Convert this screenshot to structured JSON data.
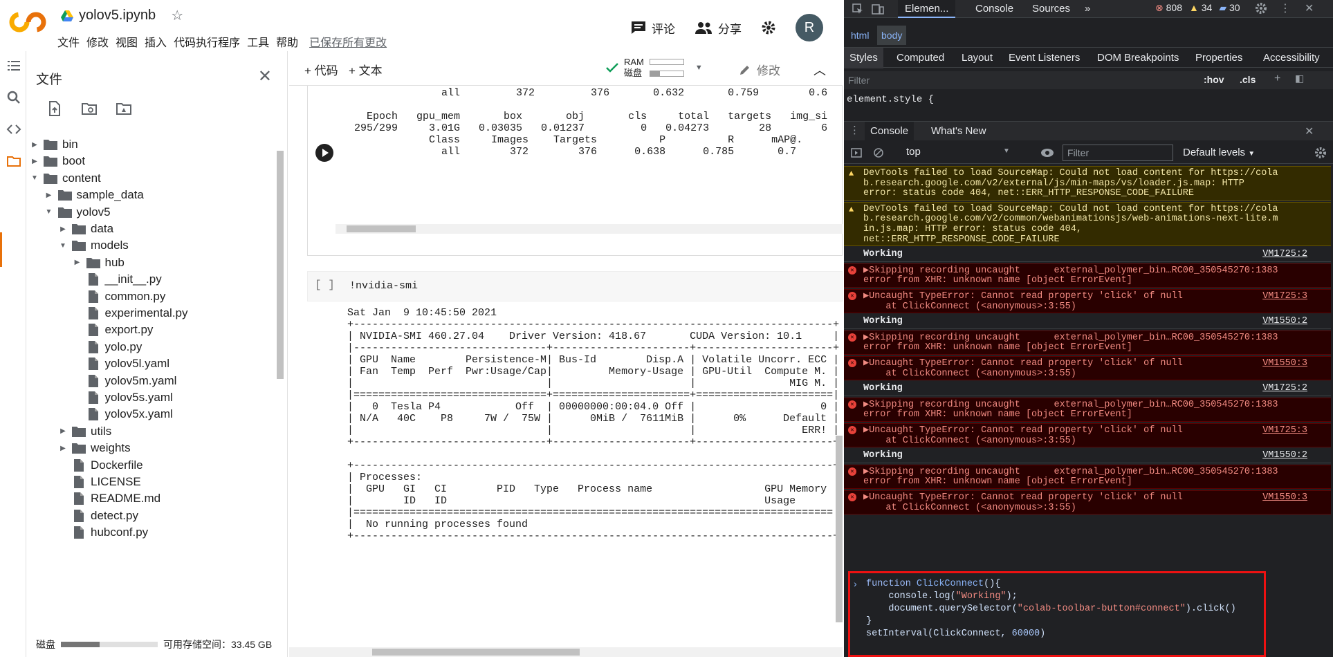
{
  "colab": {
    "logo_text": "CO",
    "notebook_title": "yolov5.ipynb",
    "menu": [
      "文件",
      "修改",
      "视图",
      "插入",
      "代码执行程序",
      "工具",
      "帮助"
    ],
    "saved_status": "已保存所有更改",
    "comment_label": "评论",
    "share_label": "分享",
    "avatar_letter": "R",
    "panel_title": "文件",
    "add_code": "+ 代码",
    "add_text": "+ 文本",
    "ram_label": "RAM",
    "disk_label": "磁盘",
    "ram_usage": 0.0,
    "disk_usage_bar": 0.3,
    "edit_label": "修改",
    "disk_footer_label": "磁盘",
    "disk_footer_usage": 0.4,
    "disk_available": "可用存储空间：33.45 GB",
    "tree": [
      {
        "name": "bin",
        "type": "folder",
        "depth": 0,
        "arrow": "right"
      },
      {
        "name": "boot",
        "type": "folder",
        "depth": 0,
        "arrow": "right"
      },
      {
        "name": "content",
        "type": "folder",
        "depth": 0,
        "arrow": "down"
      },
      {
        "name": "sample_data",
        "type": "folder",
        "depth": 1,
        "arrow": "right"
      },
      {
        "name": "yolov5",
        "type": "folder",
        "depth": 1,
        "arrow": "down"
      },
      {
        "name": "data",
        "type": "folder",
        "depth": 2,
        "arrow": "right"
      },
      {
        "name": "models",
        "type": "folder",
        "depth": 2,
        "arrow": "down"
      },
      {
        "name": "hub",
        "type": "folder",
        "depth": 3,
        "arrow": "right"
      },
      {
        "name": "__init__.py",
        "type": "file",
        "depth": 3,
        "arrow": ""
      },
      {
        "name": "common.py",
        "type": "file",
        "depth": 3,
        "arrow": ""
      },
      {
        "name": "experimental.py",
        "type": "file",
        "depth": 3,
        "arrow": ""
      },
      {
        "name": "export.py",
        "type": "file",
        "depth": 3,
        "arrow": ""
      },
      {
        "name": "yolo.py",
        "type": "file",
        "depth": 3,
        "arrow": ""
      },
      {
        "name": "yolov5l.yaml",
        "type": "file",
        "depth": 3,
        "arrow": ""
      },
      {
        "name": "yolov5m.yaml",
        "type": "file",
        "depth": 3,
        "arrow": ""
      },
      {
        "name": "yolov5s.yaml",
        "type": "file",
        "depth": 3,
        "arrow": ""
      },
      {
        "name": "yolov5x.yaml",
        "type": "file",
        "depth": 3,
        "arrow": ""
      },
      {
        "name": "utils",
        "type": "folder",
        "depth": 2,
        "arrow": "right"
      },
      {
        "name": "weights",
        "type": "folder",
        "depth": 2,
        "arrow": "right"
      },
      {
        "name": "Dockerfile",
        "type": "file",
        "depth": 2,
        "arrow": ""
      },
      {
        "name": "LICENSE",
        "type": "file",
        "depth": 2,
        "arrow": ""
      },
      {
        "name": "README.md",
        "type": "file",
        "depth": 2,
        "arrow": ""
      },
      {
        "name": "detect.py",
        "type": "file",
        "depth": 2,
        "arrow": ""
      },
      {
        "name": "hubconf.py",
        "type": "file",
        "depth": 2,
        "arrow": ""
      }
    ],
    "cell1_output": "                 all         372         376       0.632       0.759        0.6\n\n     Epoch   gpu_mem       box       obj       cls     total   targets   img_si\n   295/299     3.01G   0.03035   0.01237         0   0.04273        28        6\n               Class     Images    Targets          P          R      mAP@.\n                 all        372        376      0.638      0.785       0.7",
    "cell2_bracket": "[ ]",
    "cell2_code": "!nvidia-smi",
    "cell2_output": "Sat Jan  9 10:45:50 2021\n+-----------------------------------------------------------------------------+\n| NVIDIA-SMI 460.27.04    Driver Version: 418.67       CUDA Version: 10.1     |\n|-------------------------------+----------------------+----------------------+\n| GPU  Name        Persistence-M| Bus-Id        Disp.A | Volatile Uncorr. ECC |\n| Fan  Temp  Perf  Pwr:Usage/Cap|         Memory-Usage | GPU-Util  Compute M. |\n|                               |                      |               MIG M. |\n|===============================+======================+======================|\n|   0  Tesla P4            Off  | 00000000:00:04.0 Off |                    0 |\n| N/A   40C    P8     7W /  75W |      0MiB /  7611MiB |      0%      Default |\n|                               |                      |                 ERR! |\n+-------------------------------+----------------------+----------------------+\n\n+-----------------------------------------------------------------------------+\n| Processes:                                                                  |\n|  GPU   GI   CI        PID   Type   Process name                  GPU Memory |\n|        ID   ID                                                   Usage      |\n|=============================================================================|\n|  No running processes found                                                 |\n+-----------------------------------------------------------------------------+"
  },
  "devtools": {
    "tabs": [
      "Elemen...",
      "Console",
      "Sources"
    ],
    "more": "»",
    "errors": "808",
    "warnings": "34",
    "infos": "30",
    "breadcrumb": [
      "html",
      "body"
    ],
    "style_tabs": [
      "Styles",
      "Computed",
      "Layout",
      "Event Listeners",
      "DOM Breakpoints",
      "Properties",
      "Accessibility"
    ],
    "filter_placeholder": "Filter",
    "hov": ":hov",
    "cls": ".cls",
    "element_style": "element.style {",
    "drawer_tabs": [
      "Console",
      "What's New"
    ],
    "context": "top",
    "console_filter": "Filter",
    "levels": "Default levels",
    "messages": [
      {
        "type": "warn",
        "lines": [
          "DevTools failed to load SourceMap: Could not load content for https://cola",
          "b.research.google.com/v2/external/js/min-maps/vs/loader.js.map: HTTP",
          "error: status code 404, net::ERR_HTTP_RESPONSE_CODE_FAILURE"
        ],
        "src": ""
      },
      {
        "type": "warn",
        "lines": [
          "DevTools failed to load SourceMap: Could not load content for https://cola",
          "b.research.google.com/v2/common/webanimationsjs/web-animations-next-lite.m",
          "in.js.map: HTTP error: status code 404,",
          "net::ERR_HTTP_RESPONSE_CODE_FAILURE"
        ],
        "src": ""
      },
      {
        "type": "log",
        "lines": [
          "Working"
        ],
        "src": "VM1725:2"
      },
      {
        "type": "err",
        "lines": [
          "▶Skipping recording uncaught      external_polymer_bin…RC00_350545270:1383",
          "error from XHR: unknown name [object ErrorEvent]"
        ],
        "src": ""
      },
      {
        "type": "err",
        "lines": [
          "▶Uncaught TypeError: Cannot read property 'click' of null",
          "    at ClickConnect (<anonymous>:3:55)"
        ],
        "src": "VM1725:3"
      },
      {
        "type": "log",
        "lines": [
          "Working"
        ],
        "src": "VM1550:2"
      },
      {
        "type": "err",
        "lines": [
          "▶Skipping recording uncaught      external_polymer_bin…RC00_350545270:1383",
          "error from XHR: unknown name [object ErrorEvent]"
        ],
        "src": ""
      },
      {
        "type": "err",
        "lines": [
          "▶Uncaught TypeError: Cannot read property 'click' of null",
          "    at ClickConnect (<anonymous>:3:55)"
        ],
        "src": "VM1550:3"
      },
      {
        "type": "log",
        "lines": [
          "Working"
        ],
        "src": "VM1725:2"
      },
      {
        "type": "err",
        "lines": [
          "▶Skipping recording uncaught      external_polymer_bin…RC00_350545270:1383",
          "error from XHR: unknown name [object ErrorEvent]"
        ],
        "src": ""
      },
      {
        "type": "err",
        "lines": [
          "▶Uncaught TypeError: Cannot read property 'click' of null",
          "    at ClickConnect (<anonymous>:3:55)"
        ],
        "src": "VM1725:3"
      },
      {
        "type": "log",
        "lines": [
          "Working"
        ],
        "src": "VM1550:2"
      },
      {
        "type": "err",
        "lines": [
          "▶Skipping recording uncaught      external_polymer_bin…RC00_350545270:1383",
          "error from XHR: unknown name [object ErrorEvent]"
        ],
        "src": ""
      },
      {
        "type": "err",
        "lines": [
          "▶Uncaught TypeError: Cannot read property 'click' of null",
          "    at ClickConnect (<anonymous>:3:55)"
        ],
        "src": "VM1550:3"
      }
    ],
    "code_lines": [
      "function ClickConnect(){",
      "    console.log(\"Working\");",
      "    document.querySelector(\"colab-toolbar-button#connect\").click()",
      "}",
      "setInterval(ClickConnect, 60000)"
    ],
    "prompt": "›"
  }
}
